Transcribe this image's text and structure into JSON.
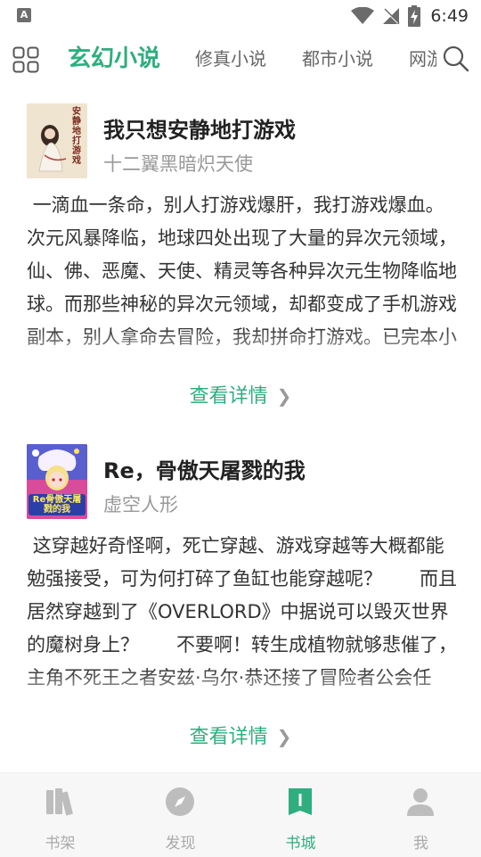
{
  "status_bar": {
    "app_letter": "A",
    "time": "6:49"
  },
  "tabs": [
    {
      "label": "玄幻小说",
      "active": true
    },
    {
      "label": "修真小说",
      "active": false
    },
    {
      "label": "都市小说",
      "active": false
    },
    {
      "label": "网游小说",
      "active": false
    }
  ],
  "books": [
    {
      "title": "我只想安静地打游戏",
      "author": "十二翼黑暗炽天使",
      "cover_text": "安静地打游戏",
      "description": " 一滴血一条命，别人打游戏爆肝，我打游戏爆血。次元风暴降临，地球四处出现了大量的异次元领域，仙、佛、恶魔、天使、精灵等各种异次元生物降临地球。而那些神秘的异次元领域，却都变成了手机游戏副本，别人拿命去冒险，我却拼命打游戏。已完本小说《超级...",
      "detail_label": "查看详情"
    },
    {
      "title": "Re，骨傲天屠戮的我",
      "author": "虚空人形",
      "cover_text": "Re骨傲天屠戮的我",
      "description": " 这穿越好奇怪啊，死亡穿越、游戏穿越等大概都能勉强接受，可为何打碎了鱼缸也能穿越呢？　　而且居然穿越到了《OVERLORD》中据说可以毁灭世界的魔树身上？　　不要啊！转生成植物就够悲催了，主角不死王之者安兹·乌尔·恭还接了冒险者公会任务，要来...",
      "detail_label": "查看详情"
    }
  ],
  "bottom_nav": [
    {
      "label": "书架",
      "icon": "books-icon",
      "active": false
    },
    {
      "label": "发现",
      "icon": "compass-icon",
      "active": false
    },
    {
      "label": "书城",
      "icon": "book-open-icon",
      "active": true
    },
    {
      "label": "我",
      "icon": "person-icon",
      "active": false
    }
  ],
  "colors": {
    "accent": "#2fae7f",
    "inactive": "#aaaaaa",
    "text": "#222222"
  }
}
